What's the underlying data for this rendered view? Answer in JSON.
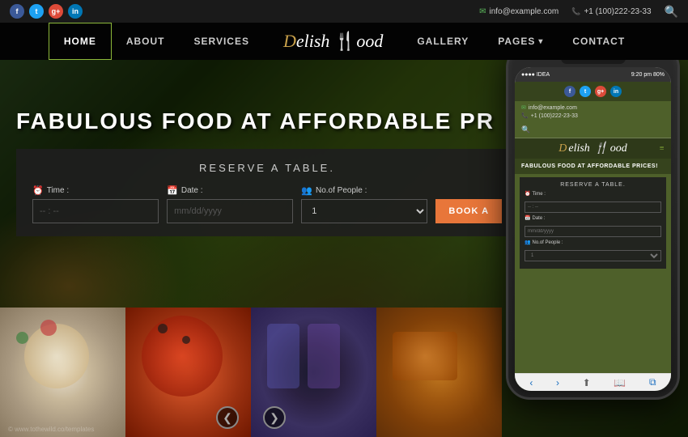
{
  "topbar": {
    "email": "info@example.com",
    "phone": "+1 (100)222-23-33"
  },
  "navbar": {
    "items": [
      {
        "label": "HOME",
        "active": true
      },
      {
        "label": "ABOUT",
        "active": false
      },
      {
        "label": "SERVICES",
        "active": false
      },
      {
        "label": "GALLERY",
        "active": false
      },
      {
        "label": "PAGES",
        "active": false,
        "dropdown": true
      },
      {
        "label": "CONTACT",
        "active": false
      }
    ],
    "brand": "Delish Food"
  },
  "hero": {
    "title": "FABULOUS FOOD AT AFFORDABLE PR",
    "reservation": {
      "title": "RESERVE A TABLE.",
      "time_label": "Time :",
      "time_placeholder": "-- : --",
      "date_label": "Date :",
      "date_placeholder": "mm/dd/yyyy",
      "people_label": "No.of People :",
      "people_placeholder": "",
      "book_label": "BOOK A"
    }
  },
  "mobile": {
    "status_left": "IDEA",
    "status_right": "9:20 pm 80%",
    "email": "info@example.com",
    "phone": "+1 (100)222-23-33",
    "brand": "Delish Food",
    "hero_text": "FABULOUS FOOD AT AFFORDABLE PRICES!",
    "reserve_title": "RESERVE A TABLE.",
    "time_label": "Time :",
    "time_placeholder": "-- : --",
    "date_label": "Date :",
    "date_placeholder": "mm/dd/yyyy",
    "people_label": "No.of People :"
  },
  "gallery": {
    "prev_label": "❮",
    "next_label": "❯"
  }
}
